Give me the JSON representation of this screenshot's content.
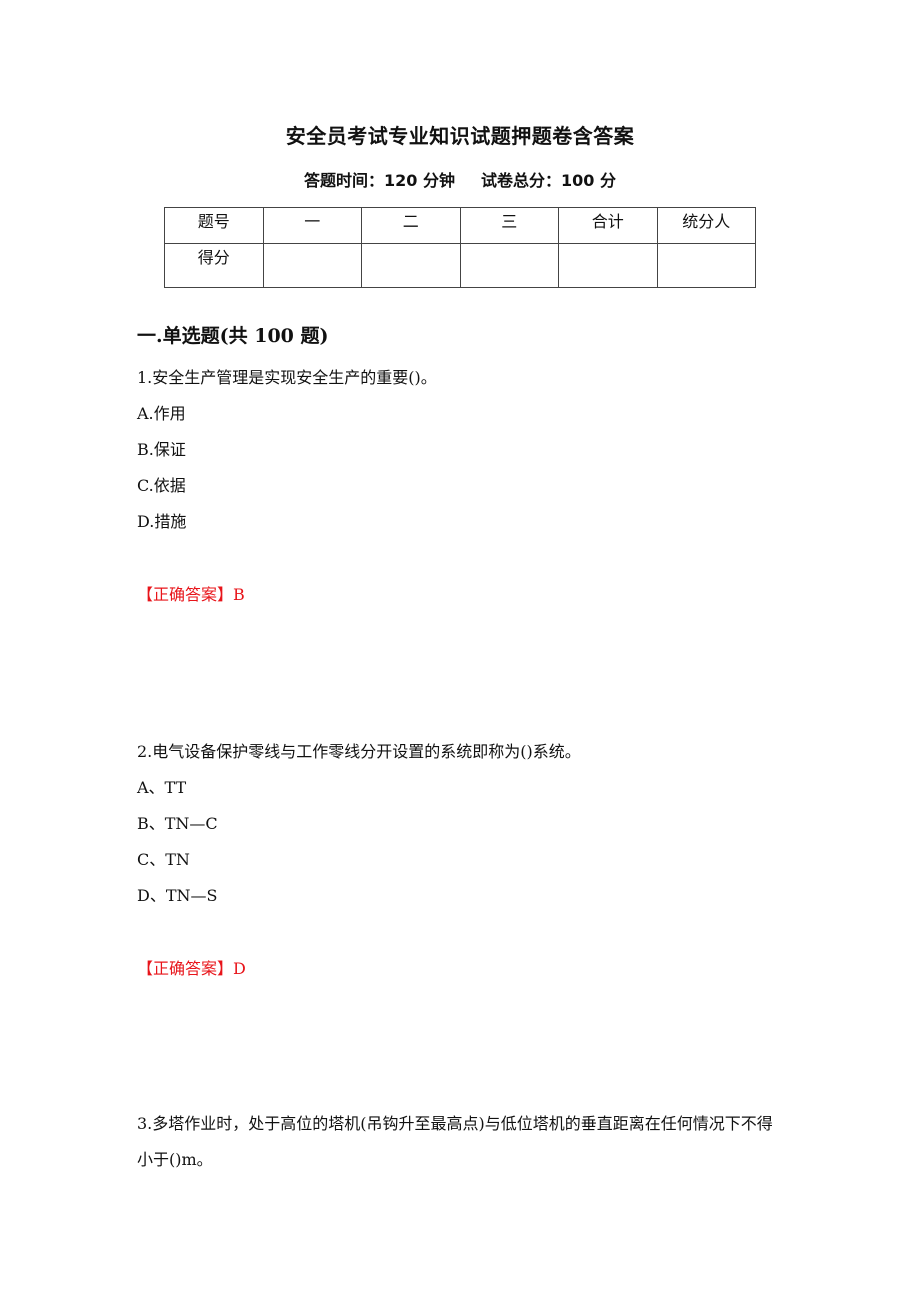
{
  "document": {
    "title": "安全员考试专业知识试题押题卷含答案",
    "meta": {
      "time_label": "答题时间：120 分钟",
      "score_label": "试卷总分：100 分"
    },
    "score_table": {
      "header": [
        "题号",
        "一",
        "二",
        "三",
        "合计",
        "统分人"
      ],
      "row": [
        "得分",
        "",
        "",
        "",
        "",
        ""
      ]
    },
    "section": {
      "heading": "一.单选题(共 100 题)"
    },
    "answer_color": "#e8141a",
    "questions": [
      {
        "text": "1.安全生产管理是实现安全生产的重要()。",
        "options": [
          "A.作用",
          "B.保证",
          "C.依据",
          "D.措施"
        ],
        "answer": "【正确答案】B"
      },
      {
        "text": "2.电气设备保护零线与工作零线分开设置的系统即称为()系统。",
        "options": [
          "A、TT",
          "B、TN—C",
          "C、TN",
          "D、TN—S"
        ],
        "answer": "【正确答案】D"
      },
      {
        "text": "3.多塔作业时，处于高位的塔机(吊钩升至最高点)与低位塔机的垂直距离在任何情况下不得小于()m。"
      }
    ]
  }
}
